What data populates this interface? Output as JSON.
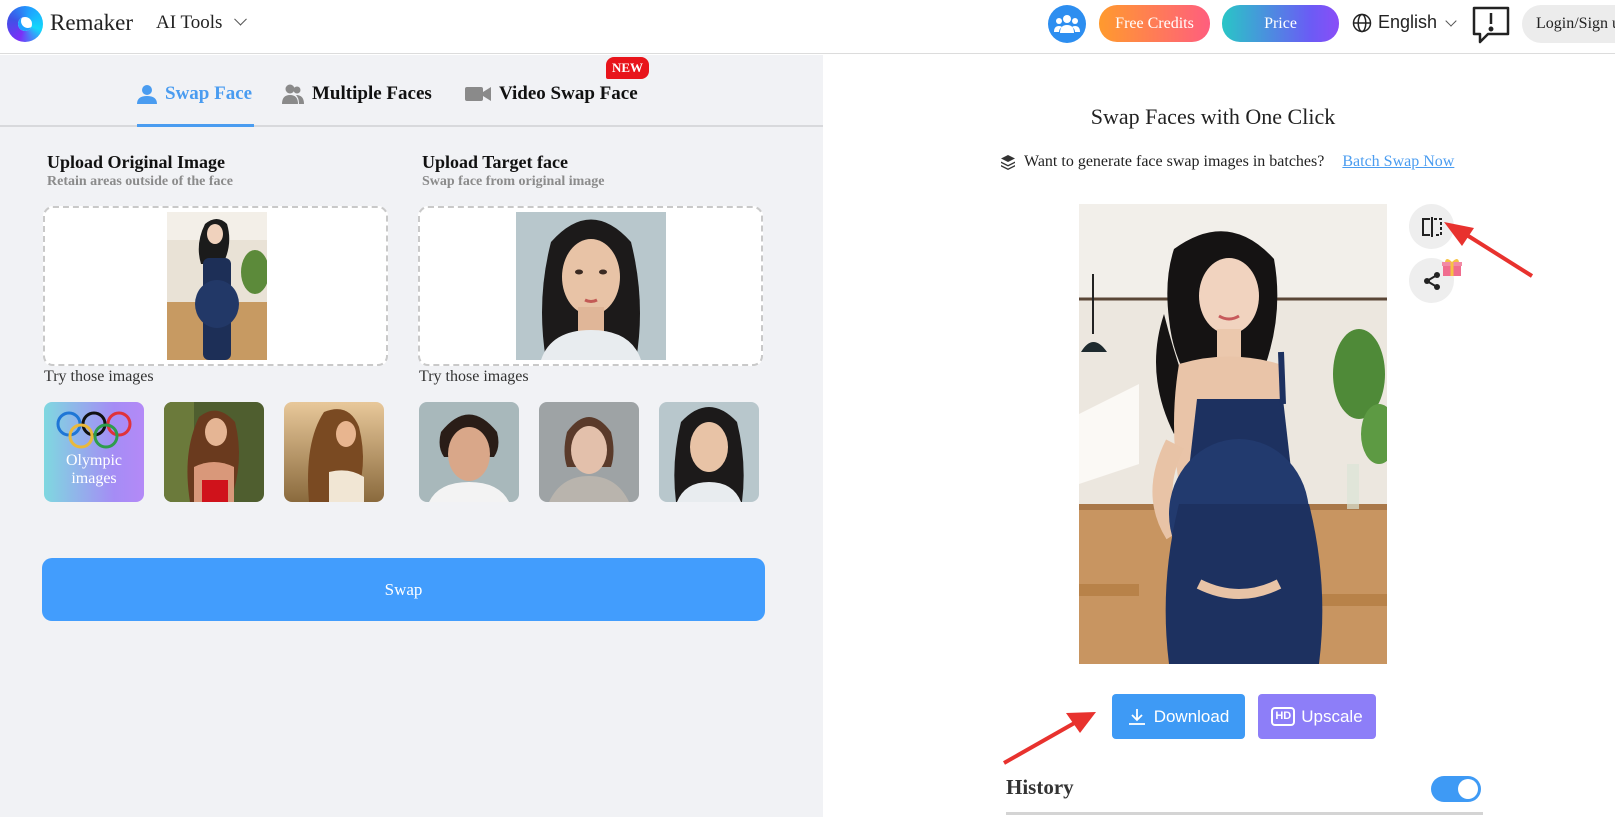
{
  "header": {
    "brand": "Remaker",
    "ai_tools": "AI Tools",
    "free_credits": "Free Credits",
    "price": "Price",
    "language": "English",
    "login": "Login/Sign up"
  },
  "left": {
    "tabs": [
      {
        "label": "Swap Face",
        "active": true,
        "icon": "user-icon"
      },
      {
        "label": "Multiple Faces",
        "active": false,
        "icon": "users-icon"
      },
      {
        "label": "Video Swap Face",
        "active": false,
        "icon": "video-icon",
        "badge": "NEW"
      }
    ],
    "original": {
      "title": "Upload Original Image",
      "subtitle": "Retain areas outside of the face",
      "try_label": "Try those images",
      "samples": [
        {
          "label": "Olympic images",
          "kind": "olympic"
        },
        {
          "label": "",
          "kind": "woman-red-top-forest"
        },
        {
          "label": "",
          "kind": "woman-sunset-hair"
        }
      ]
    },
    "target": {
      "title": "Upload Target face",
      "subtitle": "Swap face from original image",
      "try_label": "Try those images",
      "samples": [
        {
          "label": "",
          "kind": "man-curly-hair"
        },
        {
          "label": "",
          "kind": "woman-grey-sweater"
        },
        {
          "label": "",
          "kind": "asian-woman-portrait"
        }
      ]
    },
    "swap_button": "Swap"
  },
  "right": {
    "title": "Swap Faces with One Click",
    "batch_prompt": "Want to generate face swap images in batches?",
    "batch_link": "Batch Swap Now",
    "download": "Download",
    "upscale": "Upscale",
    "upscale_badge": "HD",
    "history": "History",
    "history_toggle_on": true
  },
  "colors": {
    "accent": "#429dfd",
    "tab_active": "#4a9cf0",
    "upscale": "#8d7ef8",
    "badge": "#e8141b",
    "annotation_arrow": "#e8322e"
  }
}
